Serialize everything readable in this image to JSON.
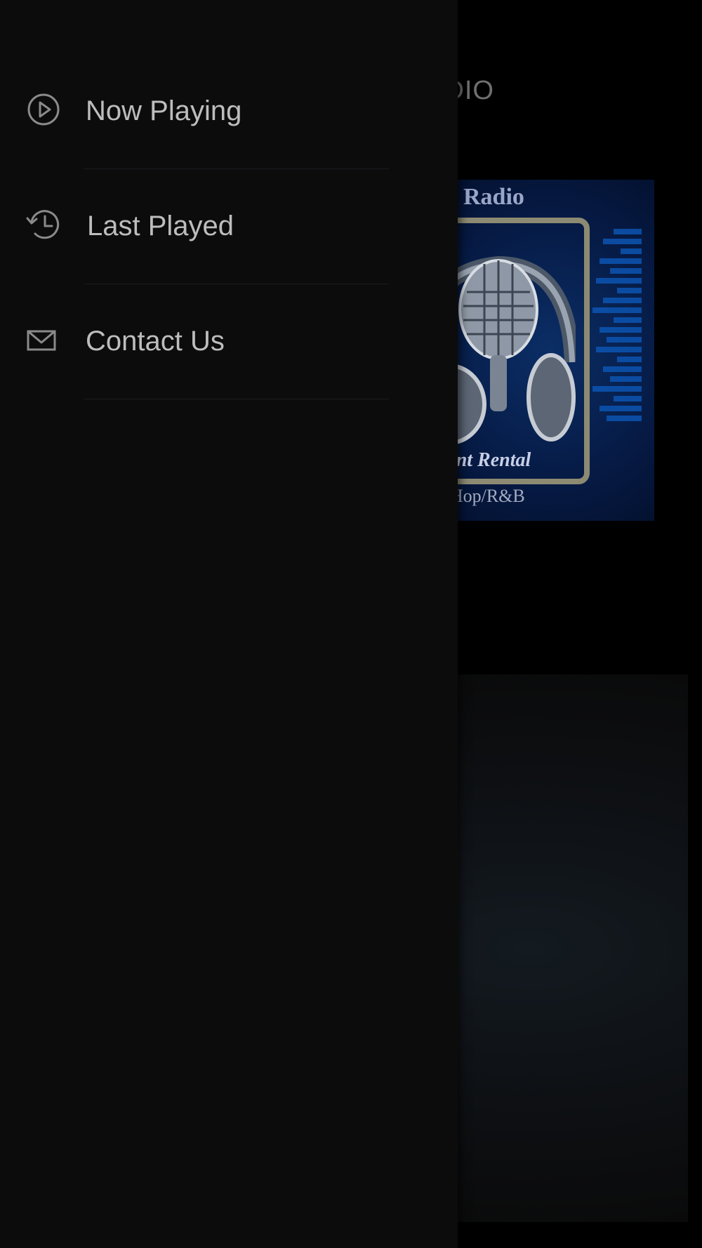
{
  "app": {
    "title": "MENT RADIO",
    "album_art": {
      "banner_text": "Radio",
      "rental_text": "ipment Rental",
      "genres_text": "es · Hip Hop/R&B"
    }
  },
  "drawer": {
    "items": [
      {
        "label": "Now Playing",
        "icon": "play-circle-icon"
      },
      {
        "label": "Last Played",
        "icon": "history-icon"
      },
      {
        "label": "Contact Us",
        "icon": "mail-icon"
      }
    ]
  },
  "colors": {
    "drawer_bg": "#0c0c0d",
    "label": "#bdbdbd",
    "icon": "#8a8a8a",
    "divider": "#1c1c1e"
  }
}
